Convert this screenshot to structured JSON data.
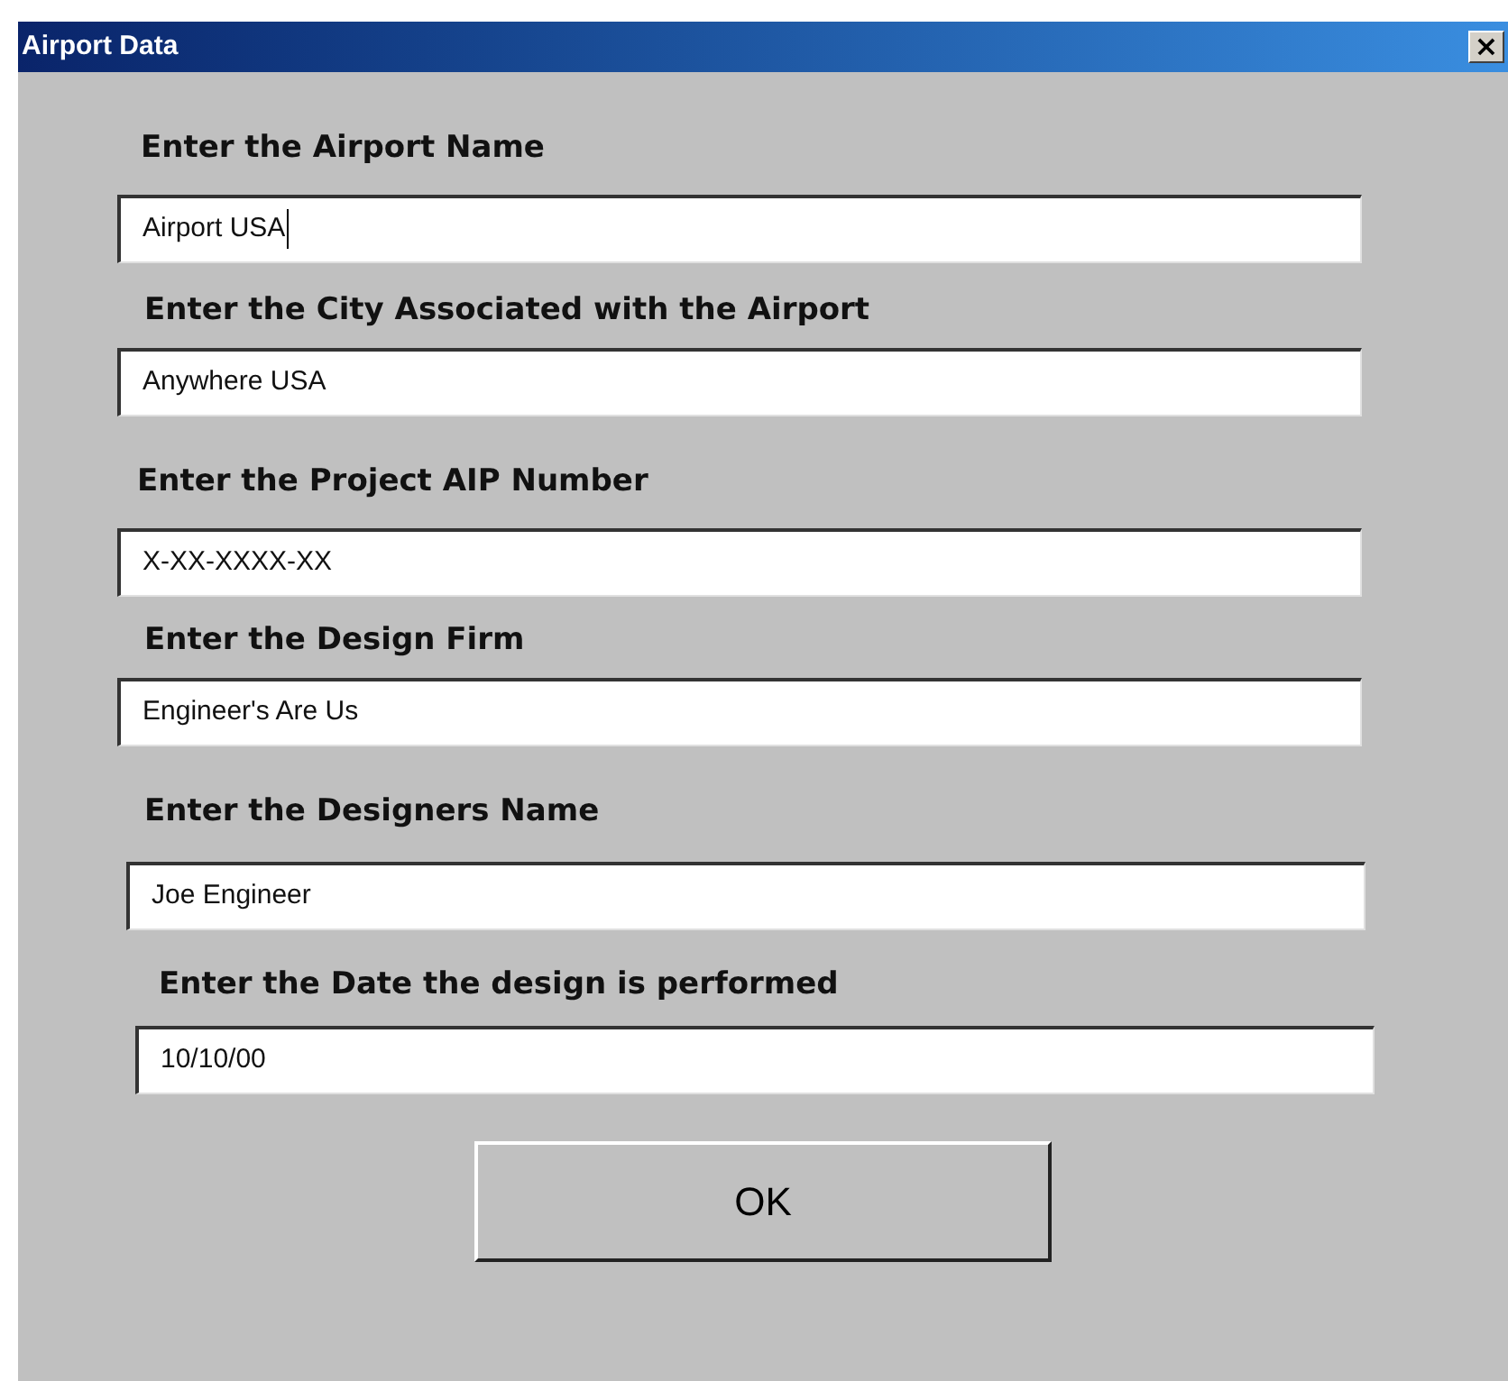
{
  "window": {
    "title": "Airport Data",
    "close": "×"
  },
  "fields": [
    {
      "label": "Enter the Airport Name",
      "value": "Airport USA",
      "focused": true
    },
    {
      "label": "Enter the City Associated with the Airport",
      "value": "Anywhere USA",
      "focused": false
    },
    {
      "label": "Enter the Project AIP Number",
      "value": "X-XX-XXXX-XX",
      "focused": false
    },
    {
      "label": "Enter the Design Firm",
      "value": "Engineer's Are Us",
      "focused": false
    },
    {
      "label": "Enter the Designers Name",
      "value": "Joe Engineer",
      "focused": false
    },
    {
      "label": "Enter the Date the design is performed",
      "value": "10/10/00",
      "focused": false
    }
  ],
  "buttons": [
    "OK"
  ]
}
